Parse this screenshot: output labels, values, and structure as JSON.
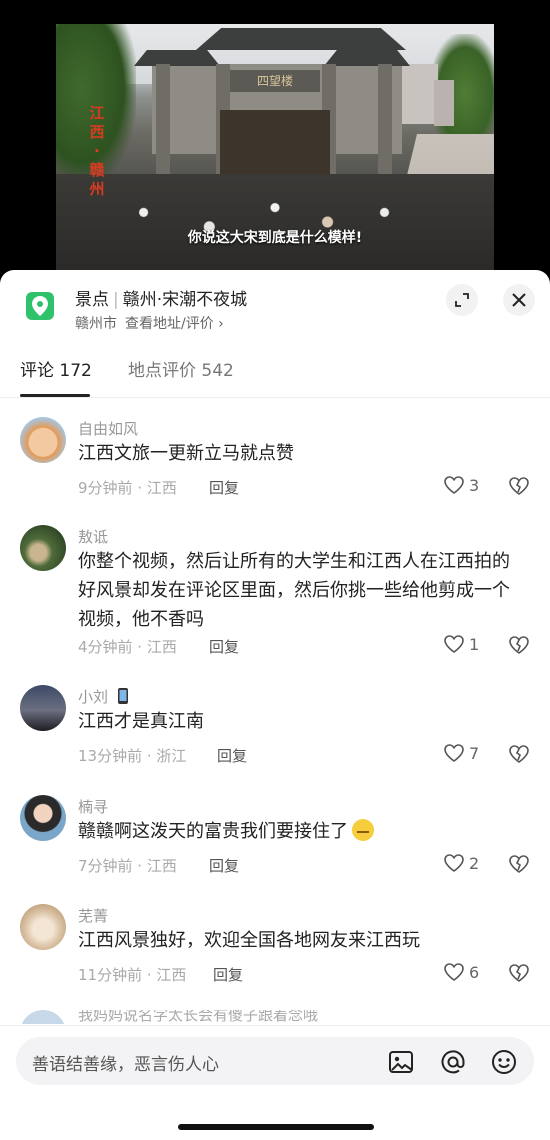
{
  "video": {
    "side_text": [
      "江",
      "西",
      "·",
      "赣",
      "州"
    ],
    "caption": "你说这大宋到底是什么模样!",
    "gate_plaque": "四望楼"
  },
  "poi": {
    "category": "景点",
    "name": "赣州·宋潮不夜城",
    "city": "赣州市",
    "address_link": "查看地址/评价 ›",
    "icon": "location-pin-icon",
    "badge_color": "#2fc26a"
  },
  "tabs": [
    {
      "label": "评论 172",
      "active": true
    },
    {
      "label": "地点评价 542",
      "active": false
    }
  ],
  "comments": [
    {
      "user": "自由如风",
      "text": "江西文旅一更新立马就点赞",
      "time": "9分钟前 · 江西",
      "reply": "回复",
      "likes": "3"
    },
    {
      "user": "敖诋",
      "text": "你整个视频，然后让所有的大学生和江西人在江西拍的好风景却发在评论区里面，然后你挑一些给他剪成一个视频，他不香吗",
      "time": "4分钟前 · 江西",
      "reply": "回复",
      "likes": "1"
    },
    {
      "user": "小刘",
      "text": "江西才是真江南",
      "time": "13分钟前 · 浙江",
      "reply": "回复",
      "likes": "7"
    },
    {
      "user": "楠寻",
      "text": "赣赣啊这泼天的富贵我们要接住了",
      "time": "7分钟前 · 江西",
      "reply": "回复",
      "likes": "2"
    },
    {
      "user": "芜菁",
      "text": "江西风景独好，欢迎全国各地网友来江西玩",
      "time": "11分钟前 · 江西",
      "reply": "回复",
      "likes": "6"
    }
  ],
  "partial_comment_user": "我妈妈说名字太长会有傻子跟着念哦",
  "input": {
    "placeholder": "善语结善缘，恶言伤人心"
  }
}
